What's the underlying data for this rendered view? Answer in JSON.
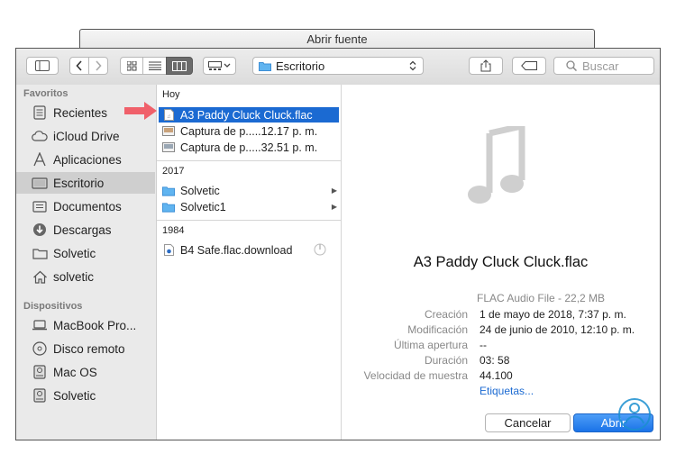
{
  "window": {
    "title": "Abrir fuente"
  },
  "toolbar": {
    "location": "Escritorio",
    "search_placeholder": "Buscar"
  },
  "sidebar": {
    "favorites_heading": "Favoritos",
    "favorites": [
      {
        "label": "Recientes",
        "icon": "recents-icon"
      },
      {
        "label": "iCloud Drive",
        "icon": "cloud-icon"
      },
      {
        "label": "Aplicaciones",
        "icon": "applications-icon"
      },
      {
        "label": "Escritorio",
        "icon": "desktop-icon",
        "selected": true
      },
      {
        "label": "Documentos",
        "icon": "document-icon"
      },
      {
        "label": "Descargas",
        "icon": "download-icon"
      },
      {
        "label": "Solvetic",
        "icon": "folder-icon"
      },
      {
        "label": "solvetic",
        "icon": "home-icon"
      }
    ],
    "devices_heading": "Dispositivos",
    "devices": [
      {
        "label": "MacBook Pro...",
        "icon": "laptop-icon"
      },
      {
        "label": "Disco remoto",
        "icon": "disc-icon"
      },
      {
        "label": "Mac OS",
        "icon": "drive-icon"
      },
      {
        "label": "Solvetic",
        "icon": "drive-icon"
      }
    ]
  },
  "column": {
    "groups": [
      {
        "heading": "Hoy",
        "items": [
          {
            "name": "A3 Paddy Cluck Cluck.flac",
            "icon": "audio-file-icon",
            "selected": true
          },
          {
            "name": "Captura de p.....12.17 p. m.",
            "icon": "screenshot-icon"
          },
          {
            "name": "Captura de p.....32.51 p. m.",
            "icon": "screenshot-icon"
          }
        ]
      },
      {
        "heading": "2017",
        "items": [
          {
            "name": "Solvetic",
            "icon": "folder-icon"
          },
          {
            "name": "Solvetic1",
            "icon": "folder-icon"
          }
        ]
      },
      {
        "heading": "1984",
        "items": [
          {
            "name": "B4 Safe.flac.download",
            "icon": "download-file-icon"
          }
        ]
      }
    ]
  },
  "preview": {
    "title": "A3 Paddy Cluck Cluck.flac",
    "kind": "FLAC Audio File - 22,2 MB",
    "meta": [
      {
        "key": "Creación",
        "value": "1 de mayo de 2018, 7:37 p. m."
      },
      {
        "key": "Modificación",
        "value": "24 de junio de 2010, 12:10 p. m."
      },
      {
        "key": "Última apertura",
        "value": "--"
      },
      {
        "key": "Duración",
        "value": "03: 58"
      },
      {
        "key": "Velocidad de muestra",
        "value": "44.100"
      }
    ],
    "tags_link": "Etiquetas..."
  },
  "buttons": {
    "cancel": "Cancelar",
    "open": "Abrir"
  },
  "colors": {
    "accent": "#1b6ad2",
    "arrow": "#f0606a",
    "selection_sidebar": "#cfcfcf"
  }
}
